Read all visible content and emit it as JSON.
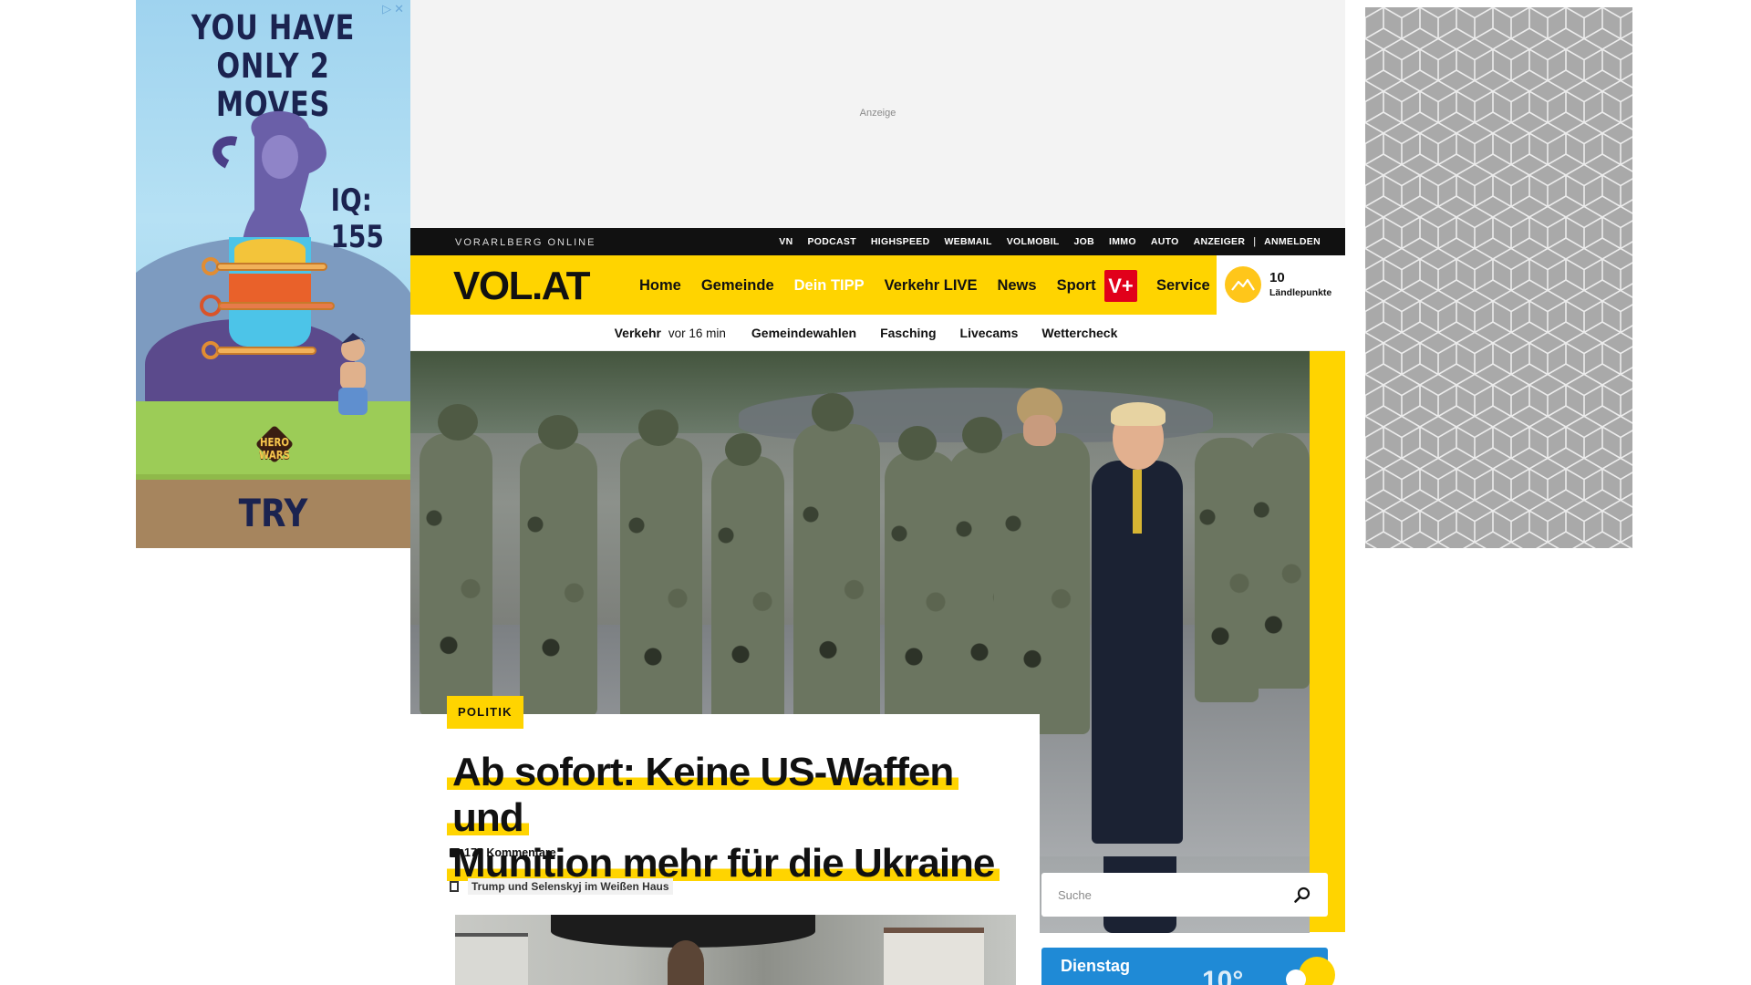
{
  "ads": {
    "left": {
      "headline": "YOU HAVE ONLY 2 MOVES",
      "iq": "IQ: 155",
      "brand": "HERO WARS",
      "cta": "TRY",
      "adchoices": "▷✕"
    },
    "top": {
      "label": "Anzeige"
    }
  },
  "topbar": {
    "site_name": "VORARLBERG ONLINE",
    "links": [
      "VN",
      "PODCAST",
      "HIGHSPEED",
      "WEBMAIL",
      "VOLMOBIL",
      "JOB",
      "IMMO",
      "AUTO",
      "ANZEIGER",
      "ANMELDEN"
    ],
    "separator": "|"
  },
  "mainnav": {
    "logo": "VOL.AT",
    "items": [
      "Home",
      "Gemeinde",
      "Dein TIPP",
      "Verkehr LIVE",
      "News",
      "Sport"
    ],
    "vplus": "V+",
    "service": "Service",
    "points_value": "10",
    "points_label": "Ländlepunkte"
  },
  "subnav": {
    "traffic_label": "Verkehr",
    "traffic_time": "vor 16 min",
    "links": [
      "Gemeindewahlen",
      "Fasching",
      "Livecams",
      "Wettercheck"
    ]
  },
  "article": {
    "kicker": "POLITIK",
    "headline_line1": "Ab sofort: Keine US-Waffen und",
    "headline_line2": "Munition mehr für die Ukraine",
    "comments": "177 Kommentare",
    "related": "Trump und Selenskyj im Weißen Haus"
  },
  "search": {
    "placeholder": "Suche"
  },
  "weather": {
    "day": "Dienstag",
    "temp": "10°"
  },
  "colors": {
    "brand_yellow": "#ffd400",
    "vplus_red": "#e1001a",
    "weather_blue": "#1f8ad6",
    "topbar": "#111111"
  }
}
